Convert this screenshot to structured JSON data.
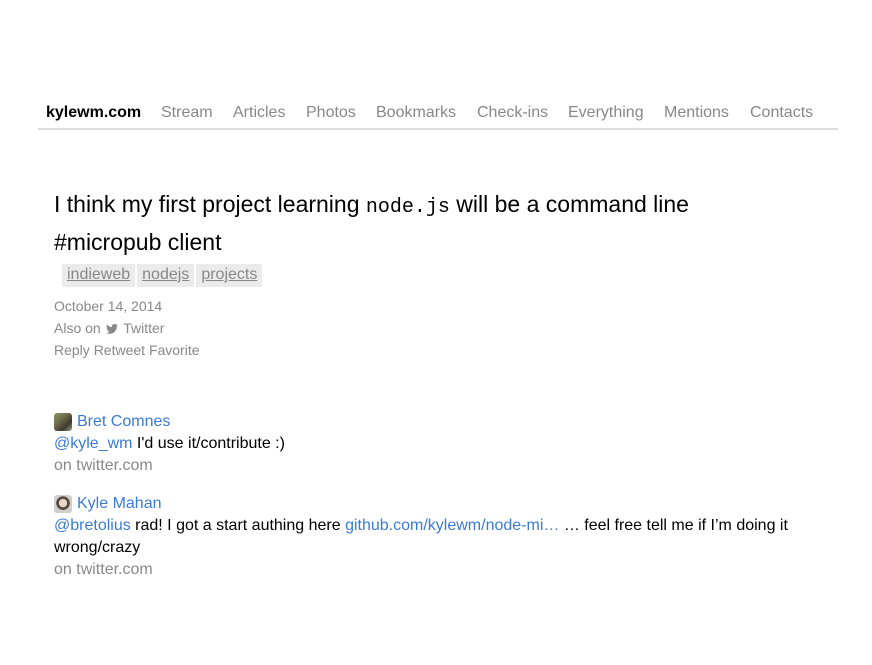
{
  "nav": {
    "home": "kylewm.com",
    "items": [
      {
        "label": "Stream"
      },
      {
        "label": "Articles"
      },
      {
        "label": "Photos"
      },
      {
        "label": "Bookmarks"
      },
      {
        "label": "Check-ins"
      },
      {
        "label": "Everything"
      },
      {
        "label": "Mentions"
      },
      {
        "label": "Contacts"
      }
    ]
  },
  "post": {
    "title_before": "I think my first project learning ",
    "title_code": "node.js",
    "title_after": " will be a command line #micropub client",
    "tags": [
      "indieweb",
      "nodejs",
      "projects"
    ],
    "date": "October 14, 2014",
    "also_on_label": "Also on",
    "also_on_icon": "twitter-bird-icon",
    "also_on_service": "Twitter",
    "actions": [
      "Reply",
      "Retweet",
      "Favorite"
    ]
  },
  "comments": [
    {
      "author": "Bret Comnes",
      "mention": "@kyle_wm",
      "text": " I'd use it/contribute :)",
      "source": "on twitter.com"
    },
    {
      "author": "Kyle Mahan",
      "mention": "@bretolius",
      "text_before": " rad! I got a start authing here ",
      "link": "github.com/kylewm/node-mi…",
      "text_after": " … feel free tell me if I’m doing it wrong/crazy",
      "source": "on twitter.com"
    }
  ],
  "colors": {
    "link": "#3b7bd6",
    "muted": "#888888",
    "tag_bg": "#ebebeb",
    "nav_rule": "#dcdcdc"
  }
}
